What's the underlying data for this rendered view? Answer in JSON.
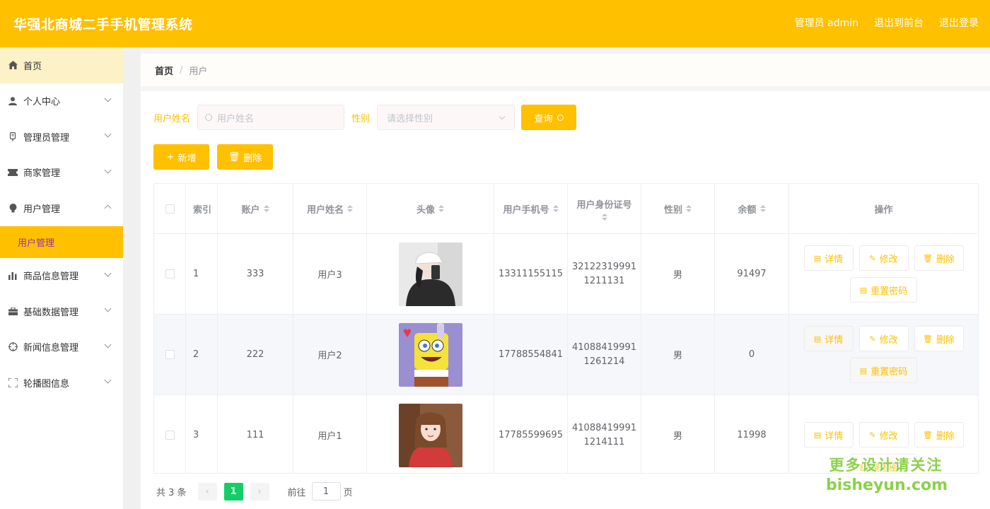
{
  "header": {
    "title": "华强北商城二手手机管理系统",
    "admin": "管理员 admin",
    "to_front": "退出到前台",
    "logout": "退出登录"
  },
  "sidebar": {
    "items": [
      {
        "label": "首页",
        "icon": "home-icon"
      },
      {
        "label": "个人中心",
        "icon": "user-icon"
      },
      {
        "label": "管理员管理",
        "icon": "admin-icon"
      },
      {
        "label": "商家管理",
        "icon": "ticket-icon"
      },
      {
        "label": "用户管理",
        "icon": "bulb-icon"
      },
      {
        "label": "商品信息管理",
        "icon": "bar-chart-icon"
      },
      {
        "label": "基础数据管理",
        "icon": "briefcase-icon"
      },
      {
        "label": "新闻信息管理",
        "icon": "aim-icon"
      },
      {
        "label": "轮播图信息",
        "icon": "fullscreen-icon"
      }
    ],
    "sub_active": "用户管理"
  },
  "breadcrumb": {
    "home": "首页",
    "sep": "/",
    "current": "用户"
  },
  "search": {
    "name_label": "用户姓名",
    "name_placeholder": "用户姓名",
    "gender_label": "性别",
    "gender_placeholder": "请选择性别",
    "query_label": "查询"
  },
  "actions": {
    "add": "新增",
    "delete": "删除",
    "add_sym": "+",
    "delete_sym": "🗑"
  },
  "table": {
    "headers": {
      "index": "索引",
      "account": "账户",
      "name": "用户姓名",
      "avatar": "头像",
      "phone": "用户手机号",
      "id_card": "用户身份证号",
      "gender": "性别",
      "balance": "余额",
      "ops": "操作"
    },
    "rows": [
      {
        "index": "1",
        "account": "333",
        "name": "用户3",
        "avatar": "girl-cap-photo",
        "phone": "13311155115",
        "id1": "32122319991",
        "id2": "1211131",
        "gender": "男",
        "balance": "91497"
      },
      {
        "index": "2",
        "account": "222",
        "name": "用户2",
        "avatar": "spongebob-photo",
        "phone": "17788554841",
        "id1": "41088419991",
        "id2": "1261214",
        "gender": "男",
        "balance": "0"
      },
      {
        "index": "3",
        "account": "111",
        "name": "用户1",
        "avatar": "girl-red-photo",
        "phone": "17785599695",
        "id1": "41088419991",
        "id2": "1214111",
        "gender": "男",
        "balance": "11998"
      }
    ],
    "ops": {
      "detail": "详情",
      "edit": "修改",
      "delete": "删除",
      "reset": "重置密码"
    }
  },
  "pager": {
    "total": "共 3 条",
    "current": "1",
    "goto": "前往",
    "page_input": "1",
    "page_unit": "页",
    "prev": "‹",
    "next": "›"
  },
  "watermark": {
    "line1": "更多设计请关注",
    "line2": "bisheyun.com"
  },
  "colors": {
    "accent": "#ffc000",
    "active_page": "#13ce66",
    "watermark": "#8cd14a"
  }
}
